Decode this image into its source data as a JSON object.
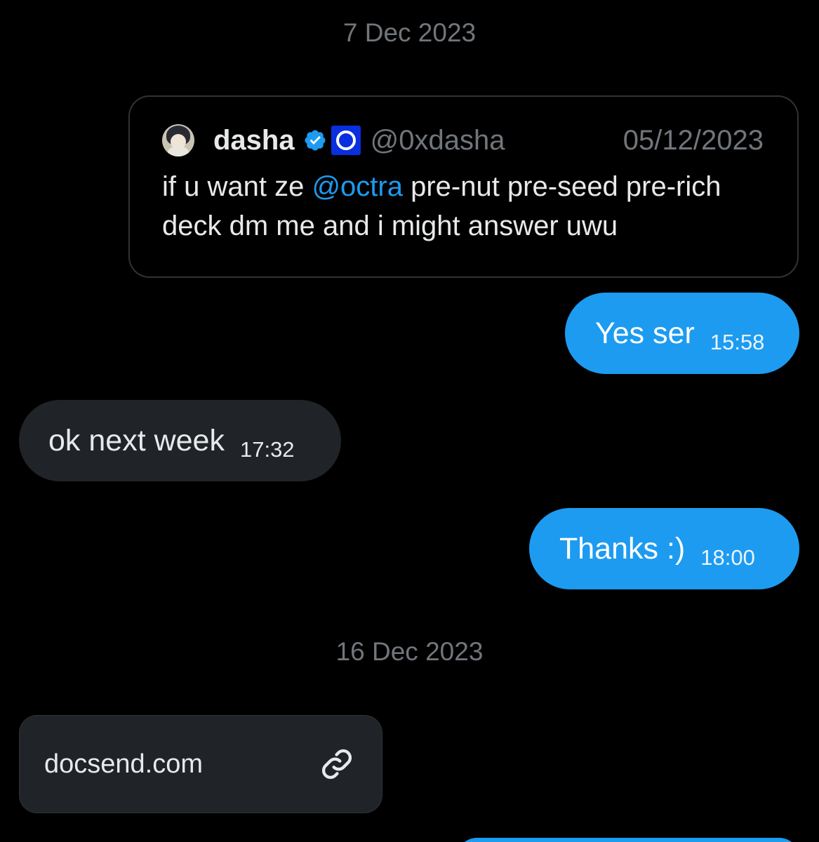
{
  "dates": {
    "first": "7 Dec 2023",
    "second": "16 Dec 2023"
  },
  "quote": {
    "name": "dasha",
    "handle": "@0xdasha",
    "date": "05/12/2023",
    "text_before": "if u want ze ",
    "mention": "@octra",
    "text_after": " pre-nut pre-seed pre-rich deck dm me and i might answer uwu",
    "avatar_icon": "avatar-anime-girl",
    "verified_icon": "verified-check-icon",
    "org_badge_icon": "octra-org-badge-icon"
  },
  "messages": [
    {
      "direction": "out",
      "text": "Yes ser",
      "time": "15:58"
    },
    {
      "direction": "in",
      "text": "ok next week",
      "time": "17:32"
    },
    {
      "direction": "out",
      "text": "Thanks :)",
      "time": "18:00"
    }
  ],
  "link_card": {
    "domain": "docsend.com",
    "icon": "link-icon"
  },
  "colors": {
    "background": "#000000",
    "outgoing_bubble": "#1d9bf0",
    "incoming_bubble": "#202327",
    "muted_text": "#71767b",
    "mention": "#1d9bf0"
  }
}
